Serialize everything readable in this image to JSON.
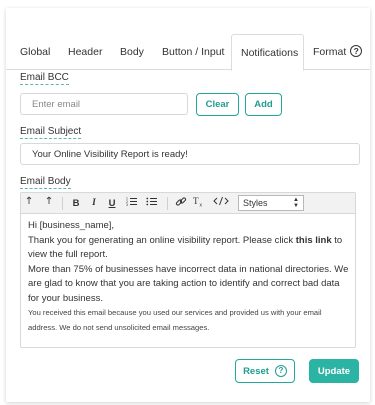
{
  "tabs": [
    {
      "label": "Global"
    },
    {
      "label": "Header"
    },
    {
      "label": "Body"
    },
    {
      "label": "Button / Input"
    },
    {
      "label": "Notifications",
      "active": true
    },
    {
      "label": "Format"
    }
  ],
  "bcc": {
    "label": "Email BCC",
    "placeholder": "Enter email",
    "clear_label": "Clear",
    "add_label": "Add"
  },
  "subject": {
    "label": "Email Subject",
    "value": "Your Online Visibility Report is ready!"
  },
  "body": {
    "label": "Email Body",
    "toolbar": {
      "undo_icon": "undo-icon",
      "redo_icon": "redo-icon",
      "bold": "B",
      "italic": "I",
      "underline": "U",
      "styles_select": "Styles"
    },
    "content": {
      "line1": "Hi [business_name],",
      "line2_pre": "Thank you for generating an online visibility report. Please click ",
      "line2_link": "this link",
      "line2_post": " to view the full report.",
      "para2": "More than 75% of businesses have incorrect data in national directories. We are glad to know that you are taking action to identify and correct bad data for your business.",
      "para3": "You received this email because you used our services and provided us with your email address. We do not send unsolicited email messages."
    }
  },
  "footer": {
    "reset_label": "Reset",
    "update_label": "Update"
  },
  "colors": {
    "accent": "#2bb3a4",
    "accent_text": "#1f9d91"
  }
}
